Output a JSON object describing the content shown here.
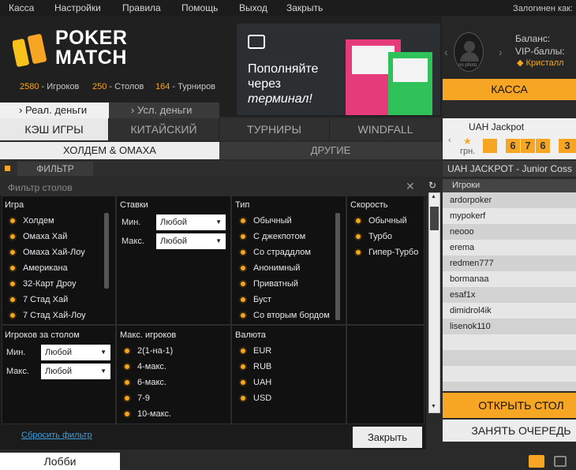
{
  "topmenu": {
    "items": [
      "Касса",
      "Настройки",
      "Правила",
      "Помощь",
      "Выход",
      "Закрыть"
    ],
    "logged_label": "Залогинен как:"
  },
  "logo": {
    "line1": "POKER",
    "line2": "MATCH"
  },
  "stats": [
    {
      "num": "2580",
      "label": " - Игроков"
    },
    {
      "num": "250",
      "label": " - Столов"
    },
    {
      "num": "164",
      "label": " - Турниров"
    }
  ],
  "banner": {
    "line1": "Пополняйте",
    "line2": "через",
    "line3": "терминал!"
  },
  "profile": {
    "no_photo": "no photo",
    "balance_label": "Баланс:",
    "vip_label": "VIP-баллы:",
    "status": "Кристалл",
    "cashier_button": "КАССА"
  },
  "money_tabs": {
    "real": "Реал. деньги",
    "conditional": "Усл. деньги"
  },
  "game_tabs": [
    "КЭШ ИГРЫ",
    "КИТАЙСКИЙ",
    "ТУРНИРЫ",
    "WINDFALL"
  ],
  "sub_tabs": [
    "ХОЛДЕМ & ОМАХА",
    "ДРУГИЕ"
  ],
  "filterbar_label": "ФИЛЬТР",
  "filter_panel": {
    "title": "Фильтр столов",
    "game": {
      "title": "Игра",
      "options": [
        "Холдем",
        "Омаха Хай",
        "Омаха Хай-Лоу",
        "Американа",
        "32-Карт Дроу",
        "7 Стад Хай",
        "7 Стад Хай-Лоу"
      ]
    },
    "stakes": {
      "title": "Ставки",
      "min_label": "Мин.",
      "max_label": "Макс.",
      "min_value": "Любой",
      "max_value": "Любой"
    },
    "type": {
      "title": "Тип",
      "options": [
        "Обычный",
        "С джекпотом",
        "Со страддлом",
        "Анонимный",
        "Приватный",
        "Буст",
        "Со вторым бордом"
      ]
    },
    "speed": {
      "title": "Скорость",
      "options": [
        "Обычный",
        "Турбо",
        "Гипер-Турбо"
      ]
    },
    "players_at_table": {
      "title": "Игроков за столом",
      "min_label": "Мин.",
      "max_label": "Макс.",
      "min_value": "Любой",
      "max_value": "Любой"
    },
    "max_players": {
      "title": "Макс. игроков",
      "options": [
        "2(1-на-1)",
        "4-макс.",
        "6-макс.",
        "7-9",
        "10-макс."
      ]
    },
    "currency": {
      "title": "Валюта",
      "options": [
        "EUR",
        "RUB",
        "UAH",
        "USD"
      ]
    },
    "reset_link": "Сбросить фильтр",
    "close_button": "Закрыть"
  },
  "jackpot": {
    "title": "UAH Jackpot",
    "currency": "грн.",
    "digits": [
      "6",
      "7",
      "6",
      "3"
    ],
    "subtitle": "UAH JACKPOT - Junior Coss"
  },
  "players_panel": {
    "header": "Игроки",
    "players": [
      "ardorpoker",
      "mypokerf",
      "neooo",
      "erema",
      "redmen777",
      "bormanaa",
      "esaf1x",
      "dimidrol4ik",
      "lisenok110"
    ]
  },
  "actions": {
    "open_table": "ОТКРЫТЬ СТОЛ",
    "take_queue": "ЗАНЯТЬ ОЧЕРЕДЬ"
  },
  "bottom": {
    "lobby_tab": "Лобби"
  },
  "colors": {
    "accent": "#f6a623",
    "background": "#2a2a2a",
    "panel": "#111111"
  }
}
